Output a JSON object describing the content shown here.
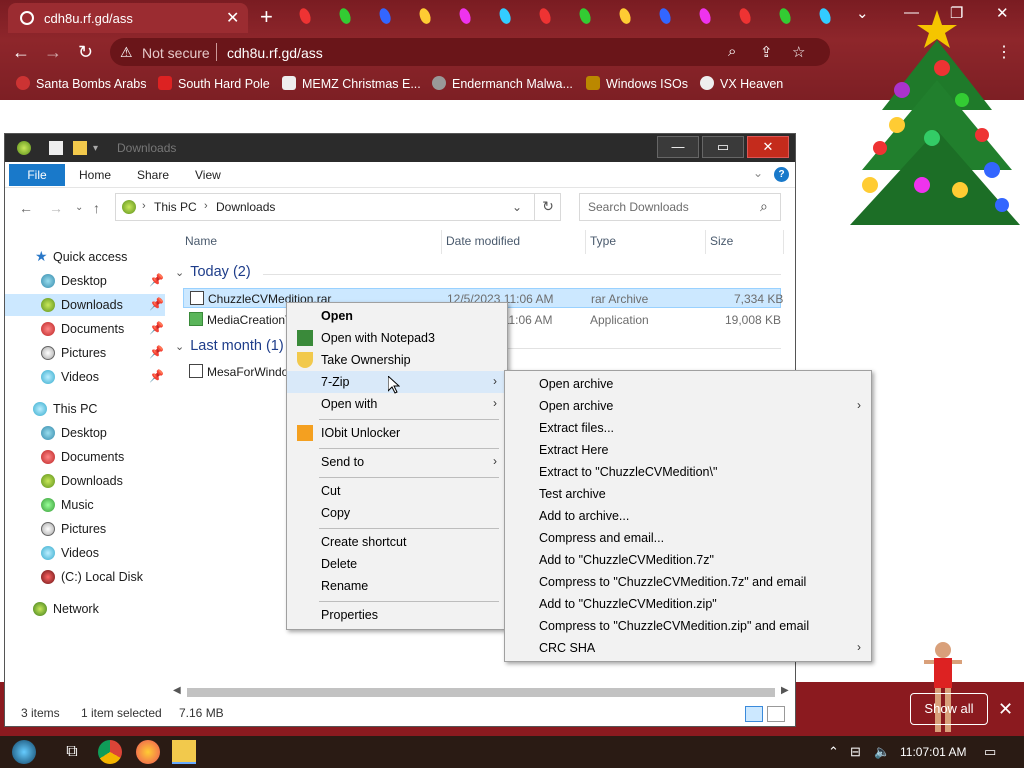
{
  "browser": {
    "tab_title": "cdh8u.rf.gd/ass",
    "security_label": "Not secure",
    "url": "cdh8u.rf.gd/ass",
    "bookmarks": [
      {
        "label": "Santa Bombs Arabs"
      },
      {
        "label": "South Hard Pole"
      },
      {
        "label": "MEMZ Christmas E..."
      },
      {
        "label": "Endermanch Malwa..."
      },
      {
        "label": "Windows ISOs"
      },
      {
        "label": "VX Heaven"
      }
    ]
  },
  "explorer": {
    "title": "Downloads",
    "ribbon_tabs": [
      "File",
      "Home",
      "Share",
      "View"
    ],
    "breadcrumb": [
      "This PC",
      "Downloads"
    ],
    "search_placeholder": "Search Downloads",
    "columns": [
      "Name",
      "Date modified",
      "Type",
      "Size"
    ],
    "nav": {
      "quick_access": "Quick access",
      "quick_items": [
        "Desktop",
        "Downloads",
        "Documents",
        "Pictures",
        "Videos"
      ],
      "this_pc": "This PC",
      "pc_items": [
        "Desktop",
        "Documents",
        "Downloads",
        "Music",
        "Pictures",
        "Videos",
        "(C:) Local Disk"
      ],
      "network": "Network"
    },
    "groups": [
      {
        "label": "Today (2)"
      },
      {
        "label": "Last month (1)"
      }
    ],
    "files": [
      {
        "name": "ChuzzleCVMedition.rar",
        "date": "12/5/2023 11:06 AM",
        "type": "rar Archive",
        "size": "7,334 KB"
      },
      {
        "name": "MediaCreationTool",
        "date": "12/5/2023 11:06 AM",
        "type": "Application",
        "size": "19,008 KB"
      },
      {
        "name": "MesaForWindows",
        "date": "",
        "type": "",
        "size": ""
      }
    ],
    "status": {
      "items": "3 items",
      "selected": "1 item selected",
      "size": "7.16 MB"
    }
  },
  "context_menu": {
    "items": [
      "Open",
      "Open with Notepad3",
      "Take Ownership",
      "7-Zip",
      "Open with",
      "IObit Unlocker",
      "Send to",
      "Cut",
      "Copy",
      "Create shortcut",
      "Delete",
      "Rename",
      "Properties"
    ]
  },
  "submenu_7zip": {
    "items": [
      "Open archive",
      "Open archive",
      "Extract files...",
      "Extract Here",
      "Extract to \"ChuzzleCVMedition\\\"",
      "Test archive",
      "Add to archive...",
      "Compress and email...",
      "Add to \"ChuzzleCVMedition.7z\"",
      "Compress to \"ChuzzleCVMedition.7z\" and email",
      "Add to \"ChuzzleCVMedition.zip\"",
      "Compress to \"ChuzzleCVMedition.zip\" and email",
      "CRC SHA"
    ]
  },
  "page": {
    "show_all_label": "Show all"
  },
  "taskbar": {
    "clock": "11:07:01 AM"
  },
  "colors": {
    "chrome_red": "#8e262b",
    "selection": "#cce8ff",
    "file_tab": "#1979ca"
  }
}
